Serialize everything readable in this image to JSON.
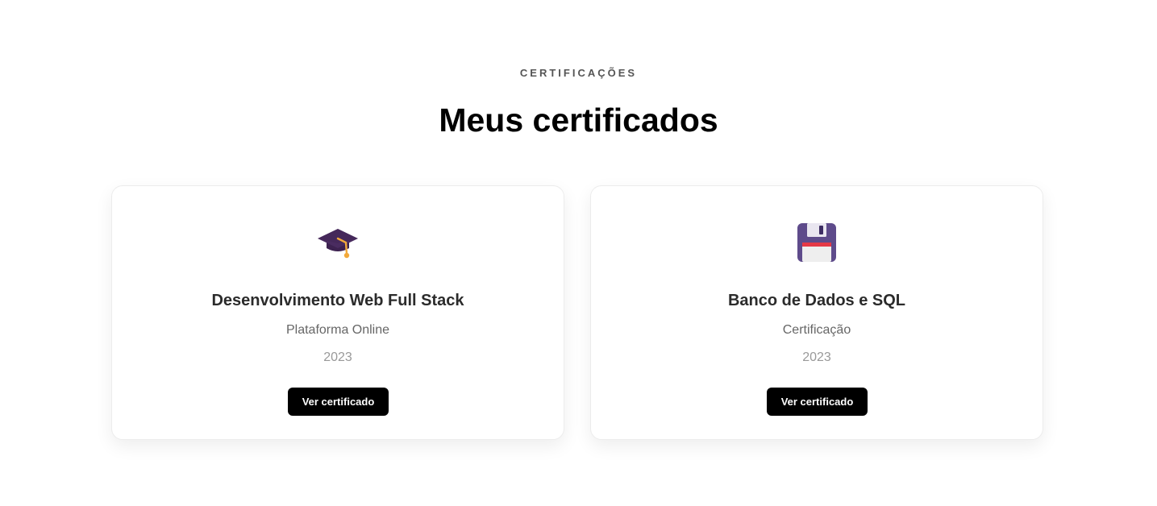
{
  "section": {
    "eyebrow": "CERTIFICAÇÕES",
    "title": "Meus certificados"
  },
  "certificates": [
    {
      "icon": "graduation-cap-icon",
      "title": "Desenvolvimento Web Full Stack",
      "issuer": "Plataforma Online",
      "year": "2023",
      "button_label": "Ver certificado"
    },
    {
      "icon": "floppy-disk-icon",
      "title": "Banco de Dados e SQL",
      "issuer": "Certificação",
      "year": "2023",
      "button_label": "Ver certificado"
    }
  ],
  "colors": {
    "button_bg": "#000000",
    "button_text": "#ffffff",
    "cap_body": "#3d2250",
    "cap_tassel": "#f2a93b",
    "floppy_body": "#5e4b8b",
    "floppy_stripe": "#e53946",
    "floppy_label": "#eeeeee"
  }
}
